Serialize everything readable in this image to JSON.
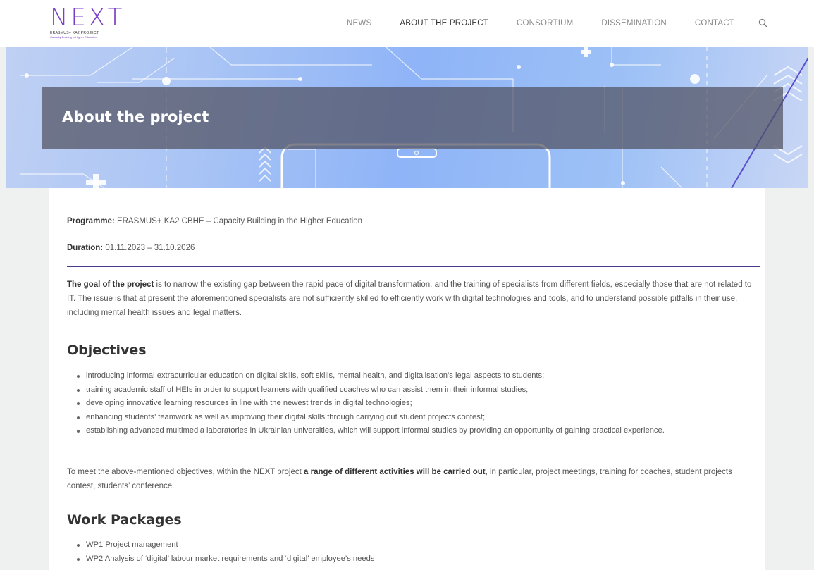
{
  "header": {
    "logo": {
      "word": "NEXT",
      "line1": "ERASMUS+ KA2 PROJECT",
      "line2": "Capacity Building in Higher Education"
    },
    "nav": [
      "NEWS",
      "ABOUT THE PROJECT",
      "CONSORTIUM",
      "DISSEMINATION",
      "CONTACT"
    ],
    "active_nav": "ABOUT THE PROJECT",
    "search_icon": "search-icon"
  },
  "hero": {
    "title": "About the project"
  },
  "info": {
    "programme_label": "Programme:",
    "programme_value": "ERASMUS+ KA2 CBHE – Capacity Building in the Higher Education",
    "duration_label": "Duration:",
    "duration_value": "01.11.2023 – 31.10.2026"
  },
  "goal": {
    "bold": "The goal of the project",
    "text": " is to narrow the existing gap between the rapid pace of digital transformation, and the training of specialists from different fields, especially those that are not related to IT. The issue is that at present the aforementioned specialists are not sufficiently skilled to efficiently work with digital technologies and tools, and to understand possible pitfalls in their use, including mental health issues and legal matters."
  },
  "objectives": {
    "heading": "Objectives",
    "items": [
      "introducing informal extracurricular education on digital skills, soft skills, mental health, and digitalisation’s legal aspects to students;",
      "training academic staff of HEIs in order to support learners with qualified coaches who can assist them in their informal studies;",
      "developing innovative learning resources in line with the newest trends in digital technologies;",
      "enhancing students’ teamwork as well as improving their digital skills through carrying out student projects contest;",
      "establishing advanced multimedia laboratories in Ukrainian universities, which will support informal studies by providing an opportunity of gaining practical experience."
    ]
  },
  "activities": {
    "pre": "To meet the above-mentioned objectives, within the NEXT project ",
    "bold": "a range of different activities will be carried out",
    "post": ", in particular, project meetings, training for coaches, student projects contest, students’ conference."
  },
  "work_packages": {
    "heading": "Work Packages",
    "items": [
      "WP1 Project management",
      "WP2 Analysis of ‘digital’ labour market requirements and ‘digital’ employee’s needs"
    ]
  },
  "colors": {
    "brand": "#7a3fc4",
    "divider": "#4a3a8c",
    "hero_band": "#50505f"
  }
}
